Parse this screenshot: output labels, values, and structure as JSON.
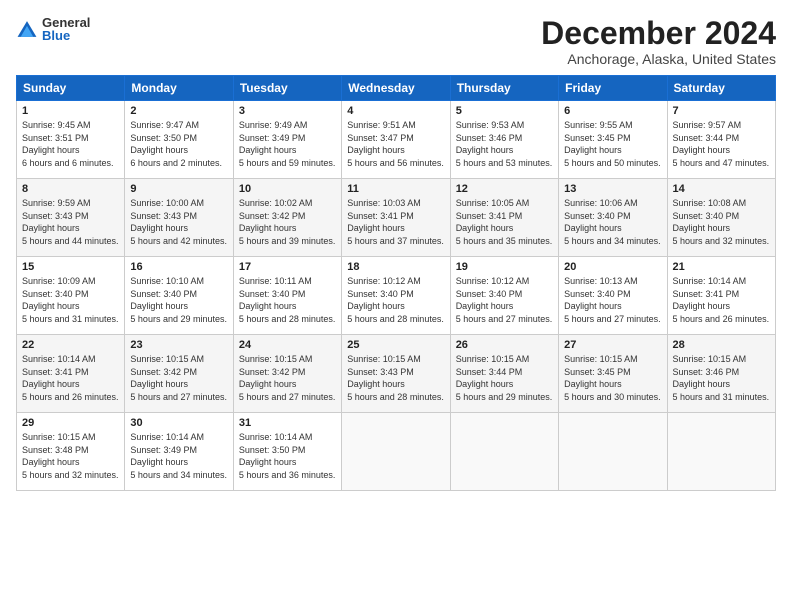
{
  "logo": {
    "general": "General",
    "blue": "Blue"
  },
  "title": "December 2024",
  "subtitle": "Anchorage, Alaska, United States",
  "days_header": [
    "Sunday",
    "Monday",
    "Tuesday",
    "Wednesday",
    "Thursday",
    "Friday",
    "Saturday"
  ],
  "weeks": [
    [
      {
        "day": "1",
        "rise": "9:45 AM",
        "set": "3:51 PM",
        "daylight": "6 hours and 6 minutes."
      },
      {
        "day": "2",
        "rise": "9:47 AM",
        "set": "3:50 PM",
        "daylight": "6 hours and 2 minutes."
      },
      {
        "day": "3",
        "rise": "9:49 AM",
        "set": "3:49 PM",
        "daylight": "5 hours and 59 minutes."
      },
      {
        "day": "4",
        "rise": "9:51 AM",
        "set": "3:47 PM",
        "daylight": "5 hours and 56 minutes."
      },
      {
        "day": "5",
        "rise": "9:53 AM",
        "set": "3:46 PM",
        "daylight": "5 hours and 53 minutes."
      },
      {
        "day": "6",
        "rise": "9:55 AM",
        "set": "3:45 PM",
        "daylight": "5 hours and 50 minutes."
      },
      {
        "day": "7",
        "rise": "9:57 AM",
        "set": "3:44 PM",
        "daylight": "5 hours and 47 minutes."
      }
    ],
    [
      {
        "day": "8",
        "rise": "9:59 AM",
        "set": "3:43 PM",
        "daylight": "5 hours and 44 minutes."
      },
      {
        "day": "9",
        "rise": "10:00 AM",
        "set": "3:43 PM",
        "daylight": "5 hours and 42 minutes."
      },
      {
        "day": "10",
        "rise": "10:02 AM",
        "set": "3:42 PM",
        "daylight": "5 hours and 39 minutes."
      },
      {
        "day": "11",
        "rise": "10:03 AM",
        "set": "3:41 PM",
        "daylight": "5 hours and 37 minutes."
      },
      {
        "day": "12",
        "rise": "10:05 AM",
        "set": "3:41 PM",
        "daylight": "5 hours and 35 minutes."
      },
      {
        "day": "13",
        "rise": "10:06 AM",
        "set": "3:40 PM",
        "daylight": "5 hours and 34 minutes."
      },
      {
        "day": "14",
        "rise": "10:08 AM",
        "set": "3:40 PM",
        "daylight": "5 hours and 32 minutes."
      }
    ],
    [
      {
        "day": "15",
        "rise": "10:09 AM",
        "set": "3:40 PM",
        "daylight": "5 hours and 31 minutes."
      },
      {
        "day": "16",
        "rise": "10:10 AM",
        "set": "3:40 PM",
        "daylight": "5 hours and 29 minutes."
      },
      {
        "day": "17",
        "rise": "10:11 AM",
        "set": "3:40 PM",
        "daylight": "5 hours and 28 minutes."
      },
      {
        "day": "18",
        "rise": "10:12 AM",
        "set": "3:40 PM",
        "daylight": "5 hours and 28 minutes."
      },
      {
        "day": "19",
        "rise": "10:12 AM",
        "set": "3:40 PM",
        "daylight": "5 hours and 27 minutes."
      },
      {
        "day": "20",
        "rise": "10:13 AM",
        "set": "3:40 PM",
        "daylight": "5 hours and 27 minutes."
      },
      {
        "day": "21",
        "rise": "10:14 AM",
        "set": "3:41 PM",
        "daylight": "5 hours and 26 minutes."
      }
    ],
    [
      {
        "day": "22",
        "rise": "10:14 AM",
        "set": "3:41 PM",
        "daylight": "5 hours and 26 minutes."
      },
      {
        "day": "23",
        "rise": "10:15 AM",
        "set": "3:42 PM",
        "daylight": "5 hours and 27 minutes."
      },
      {
        "day": "24",
        "rise": "10:15 AM",
        "set": "3:42 PM",
        "daylight": "5 hours and 27 minutes."
      },
      {
        "day": "25",
        "rise": "10:15 AM",
        "set": "3:43 PM",
        "daylight": "5 hours and 28 minutes."
      },
      {
        "day": "26",
        "rise": "10:15 AM",
        "set": "3:44 PM",
        "daylight": "5 hours and 29 minutes."
      },
      {
        "day": "27",
        "rise": "10:15 AM",
        "set": "3:45 PM",
        "daylight": "5 hours and 30 minutes."
      },
      {
        "day": "28",
        "rise": "10:15 AM",
        "set": "3:46 PM",
        "daylight": "5 hours and 31 minutes."
      }
    ],
    [
      {
        "day": "29",
        "rise": "10:15 AM",
        "set": "3:48 PM",
        "daylight": "5 hours and 32 minutes."
      },
      {
        "day": "30",
        "rise": "10:14 AM",
        "set": "3:49 PM",
        "daylight": "5 hours and 34 minutes."
      },
      {
        "day": "31",
        "rise": "10:14 AM",
        "set": "3:50 PM",
        "daylight": "5 hours and 36 minutes."
      },
      null,
      null,
      null,
      null
    ]
  ]
}
